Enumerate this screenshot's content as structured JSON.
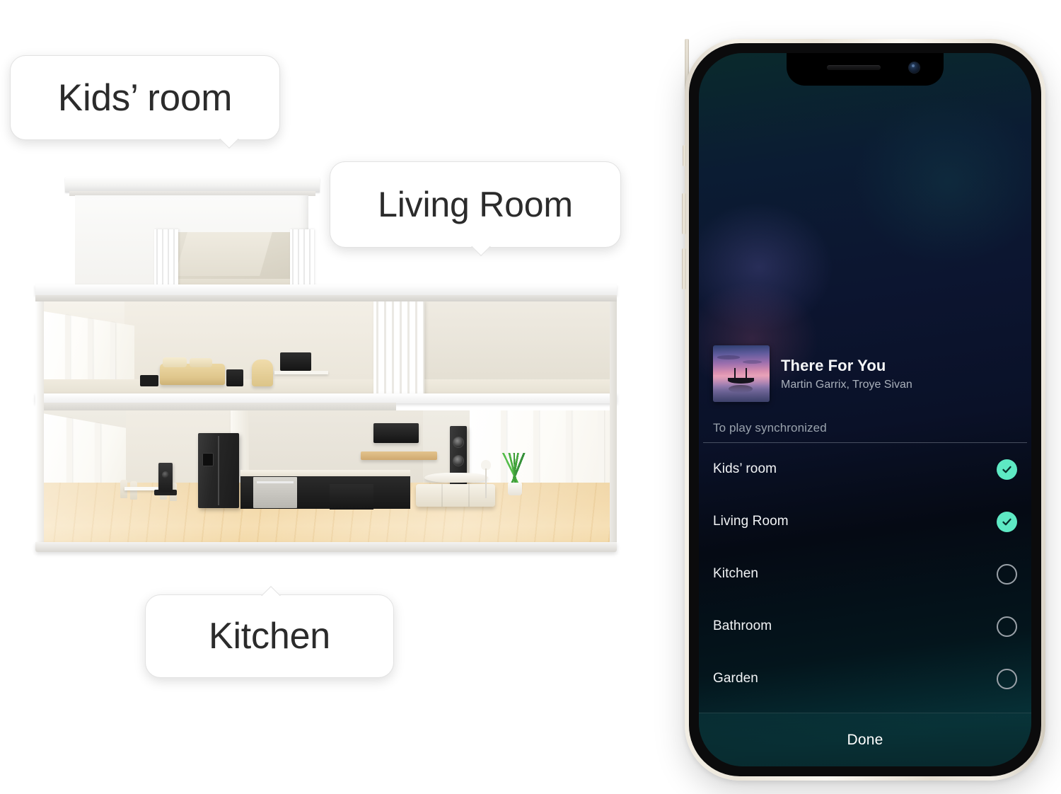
{
  "callouts": [
    {
      "id": "kids",
      "label": "Kids’ room"
    },
    {
      "id": "living",
      "label": "Living Room"
    },
    {
      "id": "kitchen",
      "label": "Kitchen"
    }
  ],
  "illustration": {
    "name": "cutaway-dollhouse",
    "levels": [
      "Kids’ room",
      "Living Room",
      "Kitchen"
    ]
  },
  "phone": {
    "device": "smartphone",
    "frame_color": "#ece6da",
    "notch": {
      "speaker": "speaker-grill",
      "camera": "front-camera"
    },
    "screen": {
      "now_playing": {
        "title": "There For You",
        "artists": "Martin Garrix, Troye Sivan",
        "artwork": "sunset-boat-album-art"
      },
      "section_label": "To play synchronized",
      "rooms": [
        {
          "name": "Kids’ room",
          "selected": true
        },
        {
          "name": "Living Room",
          "selected": true
        },
        {
          "name": "Kitchen",
          "selected": false
        },
        {
          "name": "Bathroom",
          "selected": false
        },
        {
          "name": "Garden",
          "selected": false
        }
      ],
      "done_label": "Done",
      "accent_color": "#5ee9c4",
      "unselected_color": "#9aa1a8"
    }
  }
}
